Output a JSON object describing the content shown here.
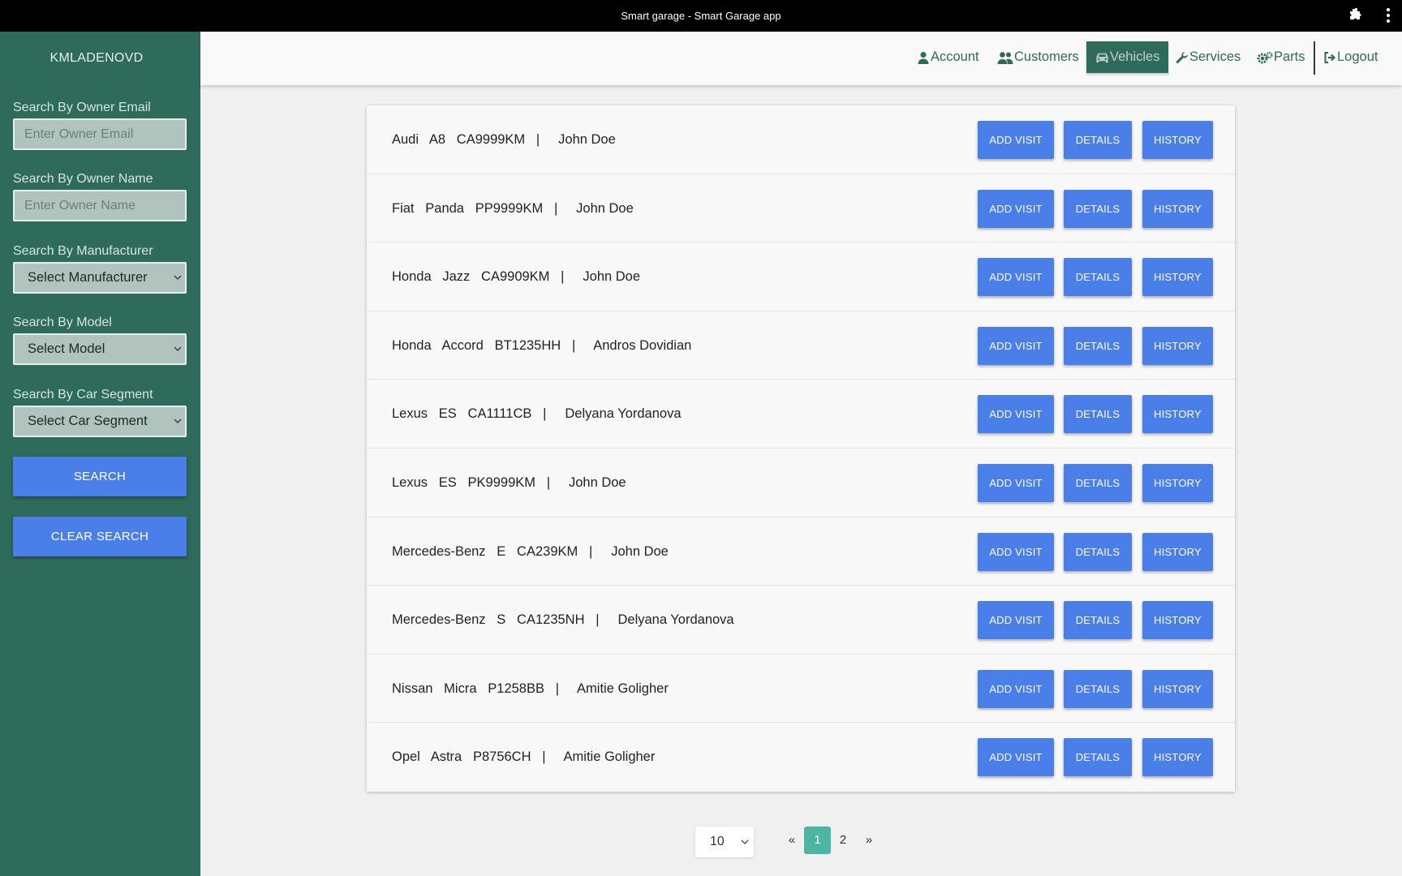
{
  "window": {
    "title": "Smart garage - Smart Garage app",
    "extensions_icon": "puzzle-icon",
    "menu_icon": "kebab-menu-icon"
  },
  "sidebar": {
    "username": "KMLADENOVD",
    "owner_email": {
      "label": "Search By Owner Email",
      "placeholder": "Enter Owner Email"
    },
    "owner_name": {
      "label": "Search By Owner Name",
      "placeholder": "Enter Owner Name"
    },
    "manufacturer": {
      "label": "Search By Manufacturer",
      "selected": "Select Manufacturer"
    },
    "model": {
      "label": "Search By Model",
      "selected": "Select Model"
    },
    "segment": {
      "label": "Search By Car Segment",
      "selected": "Select Car Segment"
    },
    "search_label": "SEARCH",
    "clear_label": "CLEAR SEARCH"
  },
  "nav": {
    "account": "Account",
    "customers": "Customers",
    "vehicles": "Vehicles",
    "services": "Services",
    "parts": "Parts",
    "logout": "Logout",
    "active": "Vehicles"
  },
  "vehicles": [
    {
      "info": "Audi   A8   CA9999KM   |     John Doe"
    },
    {
      "info": "Fiat   Panda   PP9999KM   |     John Doe"
    },
    {
      "info": "Honda   Jazz   CA9909KM   |     John Doe"
    },
    {
      "info": "Honda   Accord   BT1235HH   |     Andros Dovidian"
    },
    {
      "info": "Lexus   ES   CA1111CB   |     Delyana Yordanova"
    },
    {
      "info": "Lexus   ES   PK9999KM   |     John Doe"
    },
    {
      "info": "Mercedes-Benz   E   CA239KM   |     John Doe"
    },
    {
      "info": "Mercedes-Benz   S   CA1235NH   |     Delyana Yordanova"
    },
    {
      "info": "Nissan   Micra   P1258BB   |     Amitie Goligher"
    },
    {
      "info": "Opel   Astra   P8756CH   |     Amitie Goligher"
    }
  ],
  "row_buttons": {
    "add_visit": "ADD VISIT",
    "details": "DETAILS",
    "history": "HISTORY"
  },
  "pagination": {
    "page_size": "10",
    "prev": "«",
    "pages": [
      "1",
      "2"
    ],
    "current": "1",
    "next": "»"
  },
  "colors": {
    "sidebar": "#2e6b5a",
    "button": "#4a7fea",
    "active_page": "#4db6a3"
  }
}
